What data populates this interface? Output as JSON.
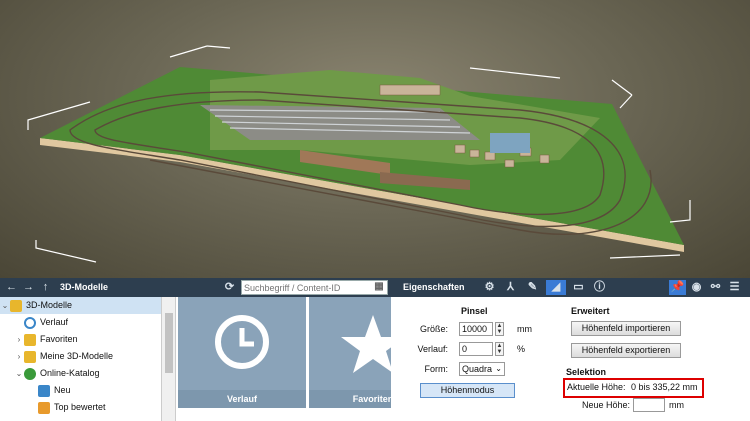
{
  "toolbar": {
    "models_title": "3D-Modelle",
    "search_placeholder": "Suchbegriff / Content-ID",
    "properties_title": "Eigenschaften"
  },
  "tree": {
    "items": [
      {
        "label": "3D-Modelle",
        "icon": "folder-icon",
        "color": "#e8b62c"
      },
      {
        "label": "Verlauf",
        "icon": "history-icon",
        "color": "#3a86c8"
      },
      {
        "label": "Favoriten",
        "icon": "star-folder-icon",
        "color": "#e8b62c"
      },
      {
        "label": "Meine 3D-Modelle",
        "icon": "folder-icon",
        "color": "#e8b62c"
      },
      {
        "label": "Online-Katalog",
        "icon": "globe-icon",
        "color": "#3a9a3a"
      },
      {
        "label": "Neu",
        "icon": "new-icon",
        "color": "#3a86c8"
      },
      {
        "label": "Top bewertet",
        "icon": "star-icon",
        "color": "#e89a2c"
      }
    ]
  },
  "tiles": [
    {
      "label": "Verlauf",
      "icon": "clock-icon"
    },
    {
      "label": "Favoriten",
      "icon": "star-icon"
    }
  ],
  "properties": {
    "brush_heading": "Pinsel",
    "size_label": "Größe:",
    "size_value": "10000",
    "size_unit": "mm",
    "gradient_label": "Verlauf:",
    "gradient_value": "0",
    "gradient_unit": "%",
    "shape_label": "Form:",
    "shape_value": "Quadra",
    "height_mode_button": "Höhenmodus",
    "advanced_heading": "Erweitert",
    "import_button": "Höhenfeld importieren",
    "export_button": "Höhenfeld exportieren",
    "selection_heading": "Selektion",
    "current_height_label": "Aktuelle Höhe:",
    "current_height_value": "0 bis 335,22 mm",
    "new_height_label": "Neue Höhe:",
    "new_height_value": "",
    "new_height_unit": "mm"
  },
  "colors": {
    "toolbar_bg": "#2d3e4f",
    "tile_bg": "#8aa3b9",
    "highlight": "#dd0000",
    "active_tab": "#3a7bd5"
  }
}
